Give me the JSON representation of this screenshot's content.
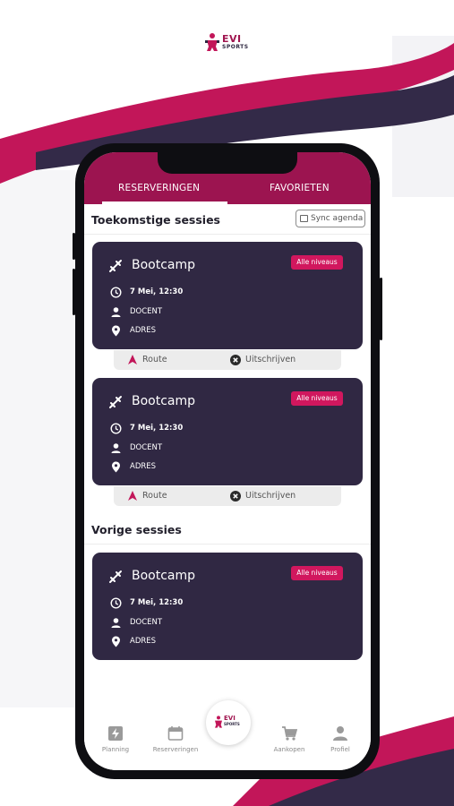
{
  "brand": {
    "name": "EVI",
    "sub": "SPORTS",
    "primary": "#9c1450",
    "accent": "#d1175e",
    "dark": "#302843"
  },
  "tabs": {
    "reservations": "RESERVERINGEN",
    "favorites": "FAVORIETEN"
  },
  "upcoming": {
    "title": "Toekomstige sessies",
    "sync_label": "Sync agenda"
  },
  "past": {
    "title": "Vorige sessies"
  },
  "sessions": [
    {
      "name": "Bootcamp",
      "level": "Alle niveaus",
      "datetime": "7 Mei, 12:30",
      "instructor": "DOCENT",
      "address": "ADRES",
      "route_label": "Route",
      "cancel_label": "Uitschrijven"
    },
    {
      "name": "Bootcamp",
      "level": "Alle niveaus",
      "datetime": "7 Mei, 12:30",
      "instructor": "DOCENT",
      "address": "ADRES",
      "route_label": "Route",
      "cancel_label": "Uitschrijven"
    },
    {
      "name": "Bootcamp",
      "level": "Alle niveaus",
      "datetime": "7 Mei, 12:30",
      "instructor": "DOCENT",
      "address": "ADRES"
    }
  ],
  "nav": {
    "planning": "Planning",
    "reservations": "Reserveringen",
    "purchases": "Aankopen",
    "profile": "Profiel"
  },
  "icons": {
    "planning": "lightning-icon",
    "reservations": "calendar-icon",
    "purchases": "cart-icon",
    "profile": "person-icon"
  }
}
